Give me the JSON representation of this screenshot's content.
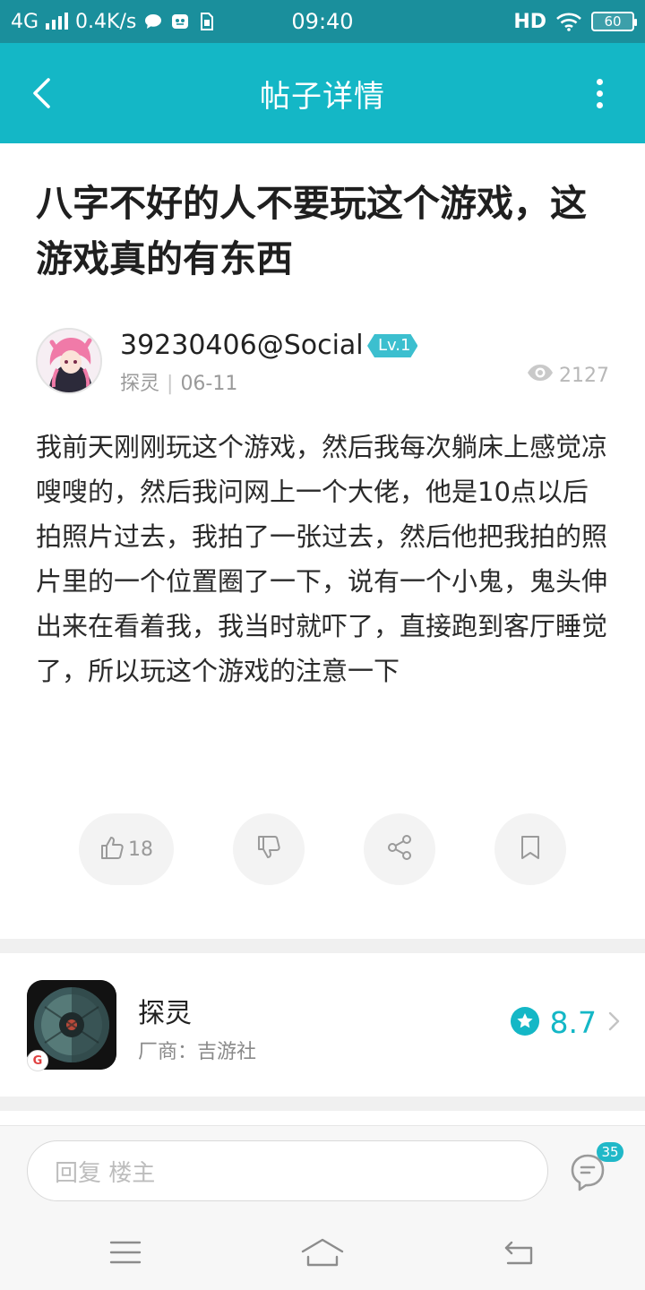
{
  "status_bar": {
    "network": "4G",
    "speed": "0.4K/s",
    "time": "09:40",
    "hd": "HD",
    "battery": "60"
  },
  "app_bar": {
    "title": "帖子详情",
    "back_icon": "back-arrow-icon",
    "more_icon": "more-vertical-icon"
  },
  "post": {
    "title": "八字不好的人不要玩这个游戏，这游戏真的有东西",
    "author": {
      "name": "39230406@Social",
      "level": "Lv.1",
      "category": "探灵",
      "separator": "|",
      "date": "06-11"
    },
    "views": "2127",
    "body": "我前天刚刚玩这个游戏，然后我每次躺床上感觉凉嗖嗖的，然后我问网上一个大佬，他是10点以后拍照片过去，我拍了一张过去，然后他把我拍的照片里的一个位置圈了一下，说有一个小鬼，鬼头伸出来在看着我，我当时就吓了，直接跑到客厅睡觉了，所以玩这个游戏的注意一下"
  },
  "actions": {
    "like_count": "18"
  },
  "game": {
    "name": "探灵",
    "maker": "厂商：吉游社",
    "score": "8.7",
    "badge": "G"
  },
  "reply": {
    "placeholder": "回复  楼主",
    "comment_count": "35"
  },
  "colors": {
    "status_bar": "#1a8f9c",
    "app_bar": "#14b7c6",
    "accent": "#14b7c6"
  }
}
